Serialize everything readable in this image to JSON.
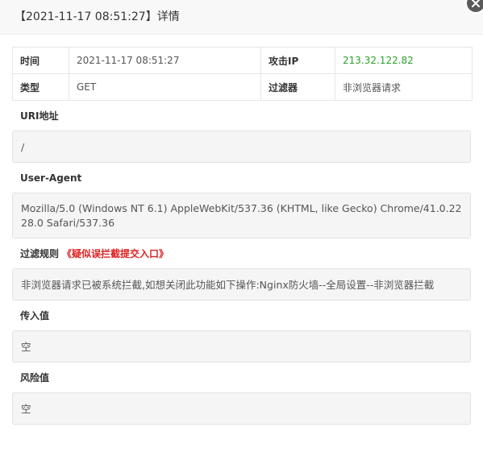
{
  "dialog": {
    "title": "【2021-11-17 08:51:27】详情"
  },
  "summary": {
    "time_label": "时间",
    "time_value": "2021-11-17 08:51:27",
    "ip_label": "攻击IP",
    "ip_value": "213.32.122.82",
    "type_label": "类型",
    "type_value": "GET",
    "filter_label": "过滤器",
    "filter_value": "非浏览器请求"
  },
  "uri": {
    "label": "URI地址",
    "value": "/"
  },
  "user_agent": {
    "label": "User-Agent",
    "value": "Mozilla/5.0 (Windows NT 6.1) AppleWebKit/537.36 (KHTML, like Gecko) Chrome/41.0.2228.0 Safari/537.36"
  },
  "filter_rule": {
    "label": "过滤规则",
    "link": "《疑似误拦截提交入口》",
    "value": "非浏览器请求已被系统拦截,如想关闭此功能如下操作:Nginx防火墙--全局设置--非浏览器拦截"
  },
  "input_value": {
    "label": "传入值",
    "value": "空"
  },
  "risk_value": {
    "label": "风险值",
    "value": "空"
  },
  "colors": {
    "ip": "#2aa12a",
    "warn": "#e02020",
    "close_bg": "#5a5a5a"
  },
  "icons": {
    "close": "close-icon"
  }
}
